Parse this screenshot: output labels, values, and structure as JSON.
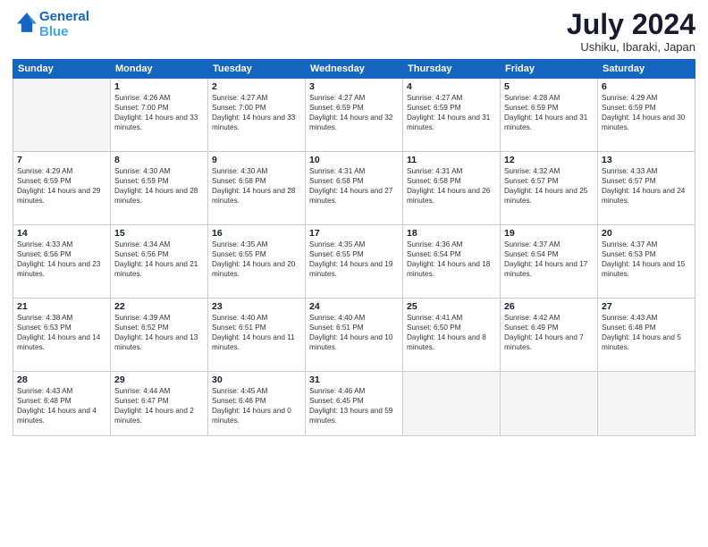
{
  "logo": {
    "line1": "General",
    "line2": "Blue"
  },
  "title": "July 2024",
  "subtitle": "Ushiku, Ibaraki, Japan",
  "days_of_week": [
    "Sunday",
    "Monday",
    "Tuesday",
    "Wednesday",
    "Thursday",
    "Friday",
    "Saturday"
  ],
  "weeks": [
    [
      {
        "num": "",
        "empty": true
      },
      {
        "num": "1",
        "rise": "4:26 AM",
        "set": "7:00 PM",
        "daylight": "14 hours and 33 minutes."
      },
      {
        "num": "2",
        "rise": "4:27 AM",
        "set": "7:00 PM",
        "daylight": "14 hours and 33 minutes."
      },
      {
        "num": "3",
        "rise": "4:27 AM",
        "set": "6:59 PM",
        "daylight": "14 hours and 32 minutes."
      },
      {
        "num": "4",
        "rise": "4:27 AM",
        "set": "6:59 PM",
        "daylight": "14 hours and 31 minutes."
      },
      {
        "num": "5",
        "rise": "4:28 AM",
        "set": "6:59 PM",
        "daylight": "14 hours and 31 minutes."
      },
      {
        "num": "6",
        "rise": "4:29 AM",
        "set": "6:59 PM",
        "daylight": "14 hours and 30 minutes."
      }
    ],
    [
      {
        "num": "7",
        "rise": "4:29 AM",
        "set": "6:59 PM",
        "daylight": "14 hours and 29 minutes."
      },
      {
        "num": "8",
        "rise": "4:30 AM",
        "set": "6:59 PM",
        "daylight": "14 hours and 28 minutes."
      },
      {
        "num": "9",
        "rise": "4:30 AM",
        "set": "6:58 PM",
        "daylight": "14 hours and 28 minutes."
      },
      {
        "num": "10",
        "rise": "4:31 AM",
        "set": "6:58 PM",
        "daylight": "14 hours and 27 minutes."
      },
      {
        "num": "11",
        "rise": "4:31 AM",
        "set": "6:58 PM",
        "daylight": "14 hours and 26 minutes."
      },
      {
        "num": "12",
        "rise": "4:32 AM",
        "set": "6:57 PM",
        "daylight": "14 hours and 25 minutes."
      },
      {
        "num": "13",
        "rise": "4:33 AM",
        "set": "6:57 PM",
        "daylight": "14 hours and 24 minutes."
      }
    ],
    [
      {
        "num": "14",
        "rise": "4:33 AM",
        "set": "6:56 PM",
        "daylight": "14 hours and 23 minutes."
      },
      {
        "num": "15",
        "rise": "4:34 AM",
        "set": "6:56 PM",
        "daylight": "14 hours and 21 minutes."
      },
      {
        "num": "16",
        "rise": "4:35 AM",
        "set": "6:55 PM",
        "daylight": "14 hours and 20 minutes."
      },
      {
        "num": "17",
        "rise": "4:35 AM",
        "set": "6:55 PM",
        "daylight": "14 hours and 19 minutes."
      },
      {
        "num": "18",
        "rise": "4:36 AM",
        "set": "6:54 PM",
        "daylight": "14 hours and 18 minutes."
      },
      {
        "num": "19",
        "rise": "4:37 AM",
        "set": "6:54 PM",
        "daylight": "14 hours and 17 minutes."
      },
      {
        "num": "20",
        "rise": "4:37 AM",
        "set": "6:53 PM",
        "daylight": "14 hours and 15 minutes."
      }
    ],
    [
      {
        "num": "21",
        "rise": "4:38 AM",
        "set": "6:53 PM",
        "daylight": "14 hours and 14 minutes."
      },
      {
        "num": "22",
        "rise": "4:39 AM",
        "set": "6:52 PM",
        "daylight": "14 hours and 13 minutes."
      },
      {
        "num": "23",
        "rise": "4:40 AM",
        "set": "6:51 PM",
        "daylight": "14 hours and 11 minutes."
      },
      {
        "num": "24",
        "rise": "4:40 AM",
        "set": "6:51 PM",
        "daylight": "14 hours and 10 minutes."
      },
      {
        "num": "25",
        "rise": "4:41 AM",
        "set": "6:50 PM",
        "daylight": "14 hours and 8 minutes."
      },
      {
        "num": "26",
        "rise": "4:42 AM",
        "set": "6:49 PM",
        "daylight": "14 hours and 7 minutes."
      },
      {
        "num": "27",
        "rise": "4:43 AM",
        "set": "6:48 PM",
        "daylight": "14 hours and 5 minutes."
      }
    ],
    [
      {
        "num": "28",
        "rise": "4:43 AM",
        "set": "6:48 PM",
        "daylight": "14 hours and 4 minutes."
      },
      {
        "num": "29",
        "rise": "4:44 AM",
        "set": "6:47 PM",
        "daylight": "14 hours and 2 minutes."
      },
      {
        "num": "30",
        "rise": "4:45 AM",
        "set": "6:46 PM",
        "daylight": "14 hours and 0 minutes."
      },
      {
        "num": "31",
        "rise": "4:46 AM",
        "set": "6:45 PM",
        "daylight": "13 hours and 59 minutes."
      },
      {
        "num": "",
        "empty": true
      },
      {
        "num": "",
        "empty": true
      },
      {
        "num": "",
        "empty": true
      }
    ]
  ]
}
